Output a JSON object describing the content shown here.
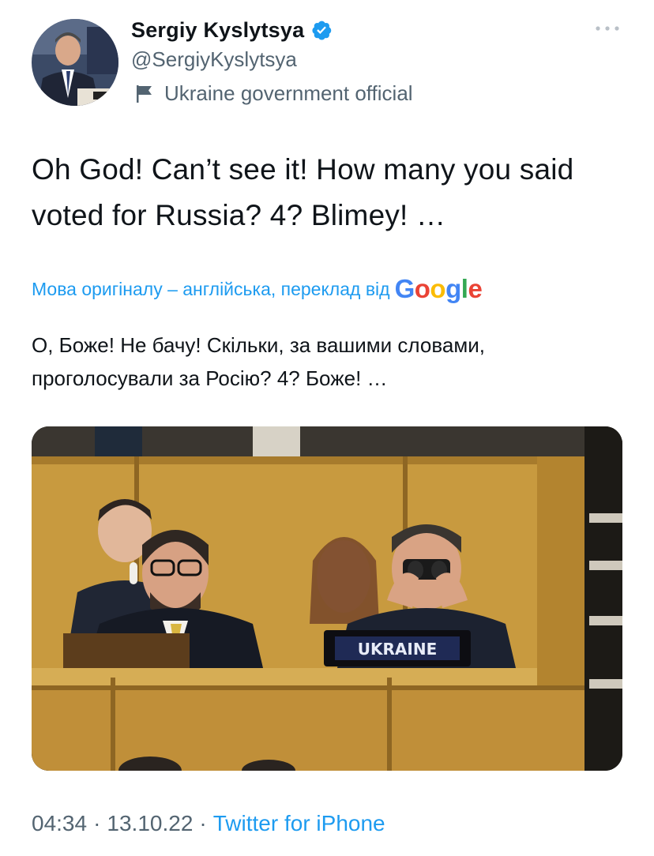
{
  "author": {
    "display_name": "Sergiy Kyslytsya",
    "handle": "@SergiyKyslytsya",
    "label": "Ukraine government official"
  },
  "icons": {
    "verified": "verified-badge-icon",
    "label": "flag-icon",
    "more": "more-options-icon"
  },
  "tweet": {
    "text": "Oh God! Can’t see it! How many you said voted for Russia? 4? Blimey! …"
  },
  "translation": {
    "label": "Мова оригіналу – англійська, переклад від",
    "provider": "Google",
    "text": "О, Боже! Не бачу! Скільки, за вашими словами, проголосували за Росію? 4? Боже! …"
  },
  "media": {
    "nameplate": "UKRAINE"
  },
  "meta": {
    "time": "04:34",
    "date": "13.10.22",
    "source": "Twitter for iPhone"
  },
  "colors": {
    "accent": "#1d9bf0",
    "secondary_text": "#536471",
    "primary_text": "#0f1419"
  }
}
